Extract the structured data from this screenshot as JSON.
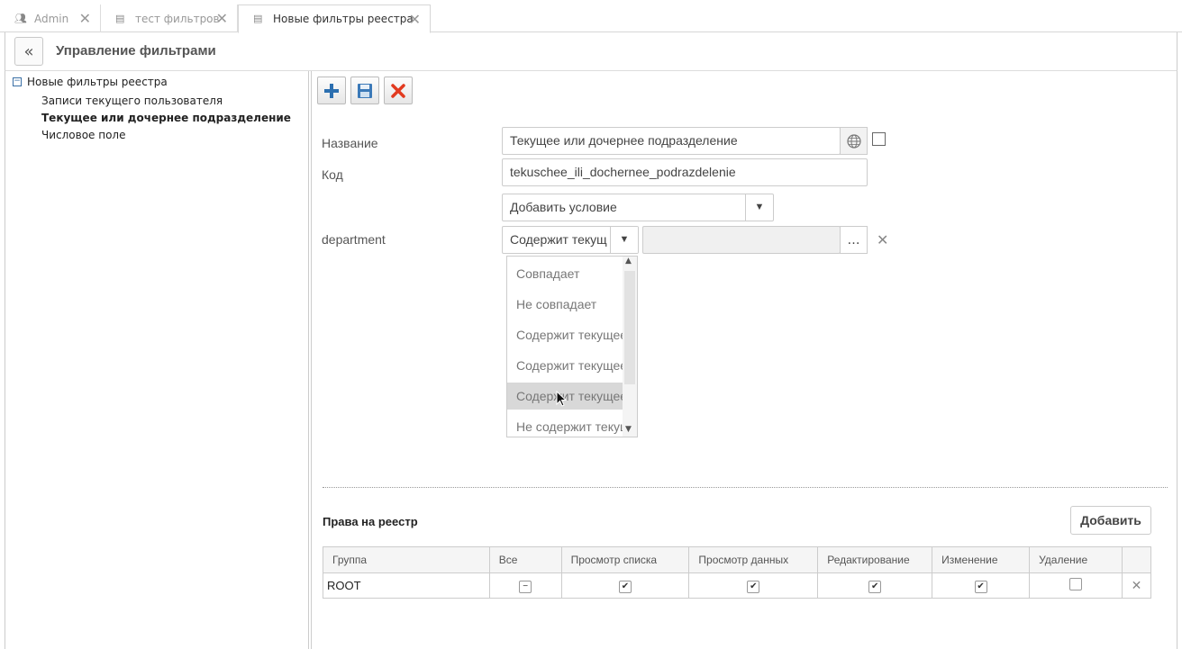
{
  "tabs": [
    {
      "label": "Admin",
      "icon": "users-icon"
    },
    {
      "label": "тест фильтров",
      "icon": "document-icon"
    },
    {
      "label": "Новые фильтры реестра",
      "icon": "list-icon"
    }
  ],
  "header": {
    "title": "Управление фильтрами"
  },
  "tree": {
    "root": "Новые фильтры реестра",
    "children": [
      "Записи текущего пользователя",
      "Текущее или дочернее подразделение",
      "Числовое поле"
    ],
    "selected_index": 1
  },
  "form": {
    "name_label": "Название",
    "name_value": "Текущее или дочернее подразделение",
    "code_label": "Код",
    "code_value": "tekuschee_ili_dochernee_podrazdelenie",
    "add_condition": "Добавить условие",
    "condition_label": "department",
    "condition_value": "Содержит текущ"
  },
  "dropdown": {
    "options": [
      "Совпадает",
      "Не совпадает",
      "Содержит текущее",
      "Содержит текущее",
      "Содержит текущее",
      "Не содержит текущ"
    ],
    "hover_index": 4
  },
  "rights": {
    "title": "Права на реестр",
    "add_label": "Добавить",
    "columns": [
      "Группа",
      "Все",
      "Просмотр списка",
      "Просмотр данных",
      "Редактирование",
      "Изменение",
      "Удаление"
    ],
    "rows": [
      {
        "group": "ROOT",
        "all": "partial",
        "list": true,
        "data": true,
        "edit": true,
        "change": true,
        "delete": false
      }
    ]
  }
}
